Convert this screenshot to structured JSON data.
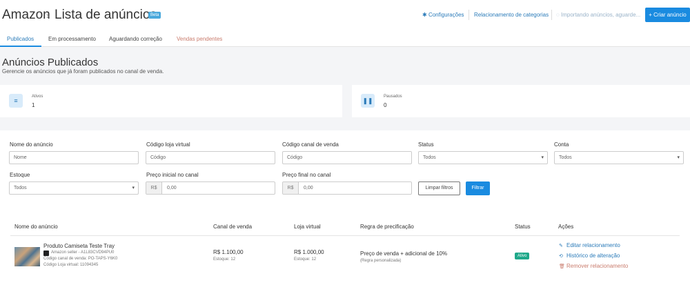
{
  "header": {
    "breadcrumb_root": "Amazon",
    "breadcrumb_sep": "›",
    "page_title": "Lista de anúncios",
    "beta_badge": "Beta",
    "links": {
      "settings": "Configurações",
      "category_mapping": "Relacionamento de categorias",
      "importing": "Importando anúncios, aguarde..."
    },
    "create_button": "+ Criar anúncio"
  },
  "tabs": [
    {
      "label": "Publicados"
    },
    {
      "label": "Em processamento"
    },
    {
      "label": "Aguardando correção"
    },
    {
      "label": "Vendas pendentes"
    }
  ],
  "section": {
    "title": "Anúncios Publicados",
    "subtitle": "Gerencie os anúncios que já foram publicados no canal de venda."
  },
  "stats": [
    {
      "label": "Ativos",
      "value": "1",
      "icon": "list-icon"
    },
    {
      "label": "Pausados",
      "value": "0",
      "icon": "pause-icon"
    }
  ],
  "filters": {
    "name_label": "Nome do anúncio",
    "name_placeholder": "Nome",
    "store_code_label": "Código loja virtual",
    "store_code_placeholder": "Código",
    "channel_code_label": "Código canal de venda",
    "channel_code_placeholder": "Código",
    "status_label": "Status",
    "status_value": "Todos",
    "account_label": "Conta",
    "account_value": "Todos",
    "stock_label": "Estoque",
    "stock_value": "Todos",
    "price_start_label": "Preço inicial no canal",
    "price_start_currency": "R$",
    "price_start_value": "0,00",
    "price_end_label": "Preço final no canal",
    "price_end_currency": "R$",
    "price_end_value": "0,00",
    "clear_button": "Limpar filtros",
    "filter_button": "Filtrar"
  },
  "table": {
    "headers": [
      "Nome do anúncio",
      "Canal de venda",
      "Loja virtual",
      "Regra de precificação",
      "Status",
      "Ações"
    ],
    "rows": [
      {
        "name": "Produto Camiseta Teste Tray",
        "seller": "Amazon seller - A1L83CVD94PU0",
        "channel_code": "Código canal de venda: PO-TAPS-Y6K0",
        "store_code": "Código Loja virtual: 11094345",
        "channel_price": "R$ 1.100,00",
        "channel_stock": "Estoque: 12",
        "store_price": "R$ 1.000,00",
        "store_stock": "Estoque: 12",
        "pricing_rule": "Preço de venda + adicional de 10%",
        "pricing_note": "(Regra personalizada)",
        "status": "Ativo",
        "actions": {
          "edit": "Editar relacionamento",
          "history": "Histórico de alteração",
          "remove": "Remover relacionamento"
        }
      }
    ]
  },
  "colors": {
    "accent": "#1a8be0",
    "link": "#2b7bb9",
    "danger": "#c97b6c",
    "success": "#1fa88a"
  }
}
